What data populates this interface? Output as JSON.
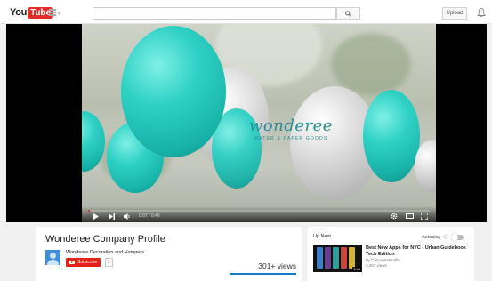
{
  "header": {
    "logo_you": "You",
    "logo_tube": "Tube",
    "search_placeholder": "",
    "upload_label": "Upload"
  },
  "player": {
    "brand_name": "wonderee",
    "brand_tagline": "WATER & PAPER GOODS",
    "time_text": "0:07 / 0:46",
    "progress": 0.005
  },
  "video": {
    "title": "Wonderee Company Profile",
    "channel": "Wonderee Decoration and Hampers",
    "subscribe_label": "Subscribe",
    "subscriber_count": "1",
    "views": "301+ views"
  },
  "sidebar": {
    "up_next_label": "Up Next",
    "autoplay_label": "Autoplay",
    "recommended": [
      {
        "title": "Best New Apps for NYC - Urban Guidebook Tech Edition",
        "author": "by CorporateProfile",
        "views": "3,257 views",
        "duration": "4:44"
      }
    ]
  },
  "colors": {
    "brand_red": "#e52d27",
    "subscribe_red": "#e62117",
    "link_blue": "#167ac6",
    "balloon_teal": "#2fd1c5",
    "balloon_grey": "#d0d0d0"
  },
  "icons": [
    "guide-menu-icon",
    "search-icon",
    "notification-bell-icon",
    "play-icon",
    "next-icon",
    "volume-icon",
    "settings-icon",
    "theater-mode-icon",
    "fullscreen-icon",
    "info-icon"
  ]
}
